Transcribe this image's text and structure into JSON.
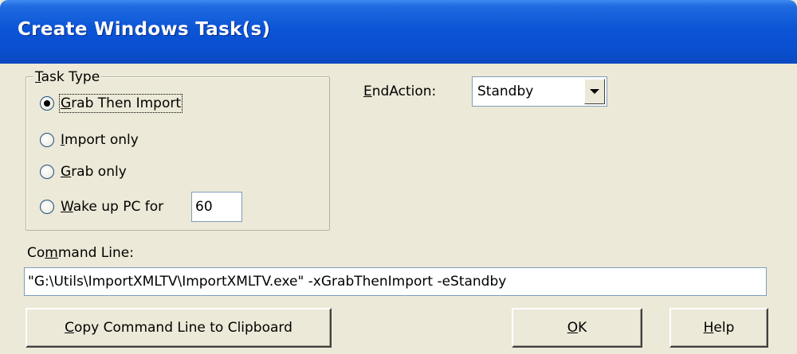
{
  "window": {
    "title": "Create Windows Task(s)"
  },
  "task_type": {
    "legend_accel": "T",
    "legend_rest": "ask Type",
    "options": [
      {
        "accel": "G",
        "rest": "rab Then Import",
        "selected": true
      },
      {
        "accel": "I",
        "rest": "mport only",
        "selected": false
      },
      {
        "accel": "G",
        "rest": "rab only",
        "selected": false
      },
      {
        "accel": "W",
        "rest": "ake up PC for",
        "selected": false
      }
    ],
    "wake_minutes": "60"
  },
  "end_action": {
    "label_accel": "E",
    "label_rest": "ndAction:",
    "value": "Standby"
  },
  "command_line": {
    "label_pre": "Co",
    "label_accel": "m",
    "label_rest": "mand Line:",
    "value": "\"G:\\Utils\\ImportXMLTV\\ImportXMLTV.exe\" -xGrabThenImport -eStandby"
  },
  "buttons": {
    "copy_accel": "C",
    "copy_rest": "opy Command Line to Clipboard",
    "ok_accel": "O",
    "ok_rest": "K",
    "help_accel": "H",
    "help_rest": "elp"
  },
  "colors": {
    "titlebar": "#0b55d6",
    "dialog_bg": "#ece9d8",
    "radio_selected": "#2c9a2c"
  }
}
